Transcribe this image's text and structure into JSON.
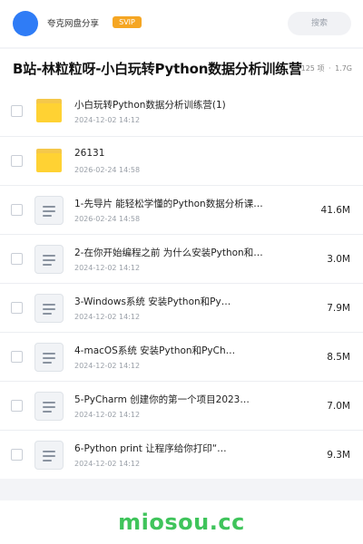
{
  "header": {
    "site_name": "夸克网盘分享",
    "badge": "SVIP",
    "search_placeholder": "搜索"
  },
  "folder": {
    "title": "B站-林粒粒呀-小白玩转Python数据分析训练营",
    "item_count": "125 项",
    "total_size": "1.7G"
  },
  "files": [
    {
      "type": "folder",
      "name": "小白玩转Python数据分析训练营(1)",
      "date": "2024-12-02 14:12",
      "size": ""
    },
    {
      "type": "folder",
      "name": "26131",
      "date": "2026-02-24 14:58",
      "size": ""
    },
    {
      "type": "file",
      "name": "1-先导片   能轻松学懂的Python数据分析课…",
      "date": "2026-02-24 14:58",
      "size": "41.6M"
    },
    {
      "type": "file",
      "name": "2-在你开始编程之前   为什么安装Python和…",
      "date": "2024-12-02 14:12",
      "size": "3.0M"
    },
    {
      "type": "file",
      "name": "3-Windows系统   安装Python和Py…",
      "date": "2024-12-02 14:12",
      "size": "7.9M"
    },
    {
      "type": "file",
      "name": "4-macOS系统   安装Python和PyCh…",
      "date": "2024-12-02 14:12",
      "size": "8.5M"
    },
    {
      "type": "file",
      "name": "5-PyCharm   创建你的第一个项目2023…",
      "date": "2024-12-02 14:12",
      "size": "7.0M"
    },
    {
      "type": "file",
      "name": "6-Python print   让程序给你打印“…",
      "date": "2024-12-02 14:12",
      "size": "9.3M"
    }
  ],
  "watermark": "miosou.cc",
  "colors": {
    "accent": "#2f7cf6",
    "badge": "#f5a623",
    "folder": "#ffd233",
    "watermark": "#3fc45b"
  },
  "icons": {
    "folder": "folder-icon",
    "file": "document-icon"
  }
}
